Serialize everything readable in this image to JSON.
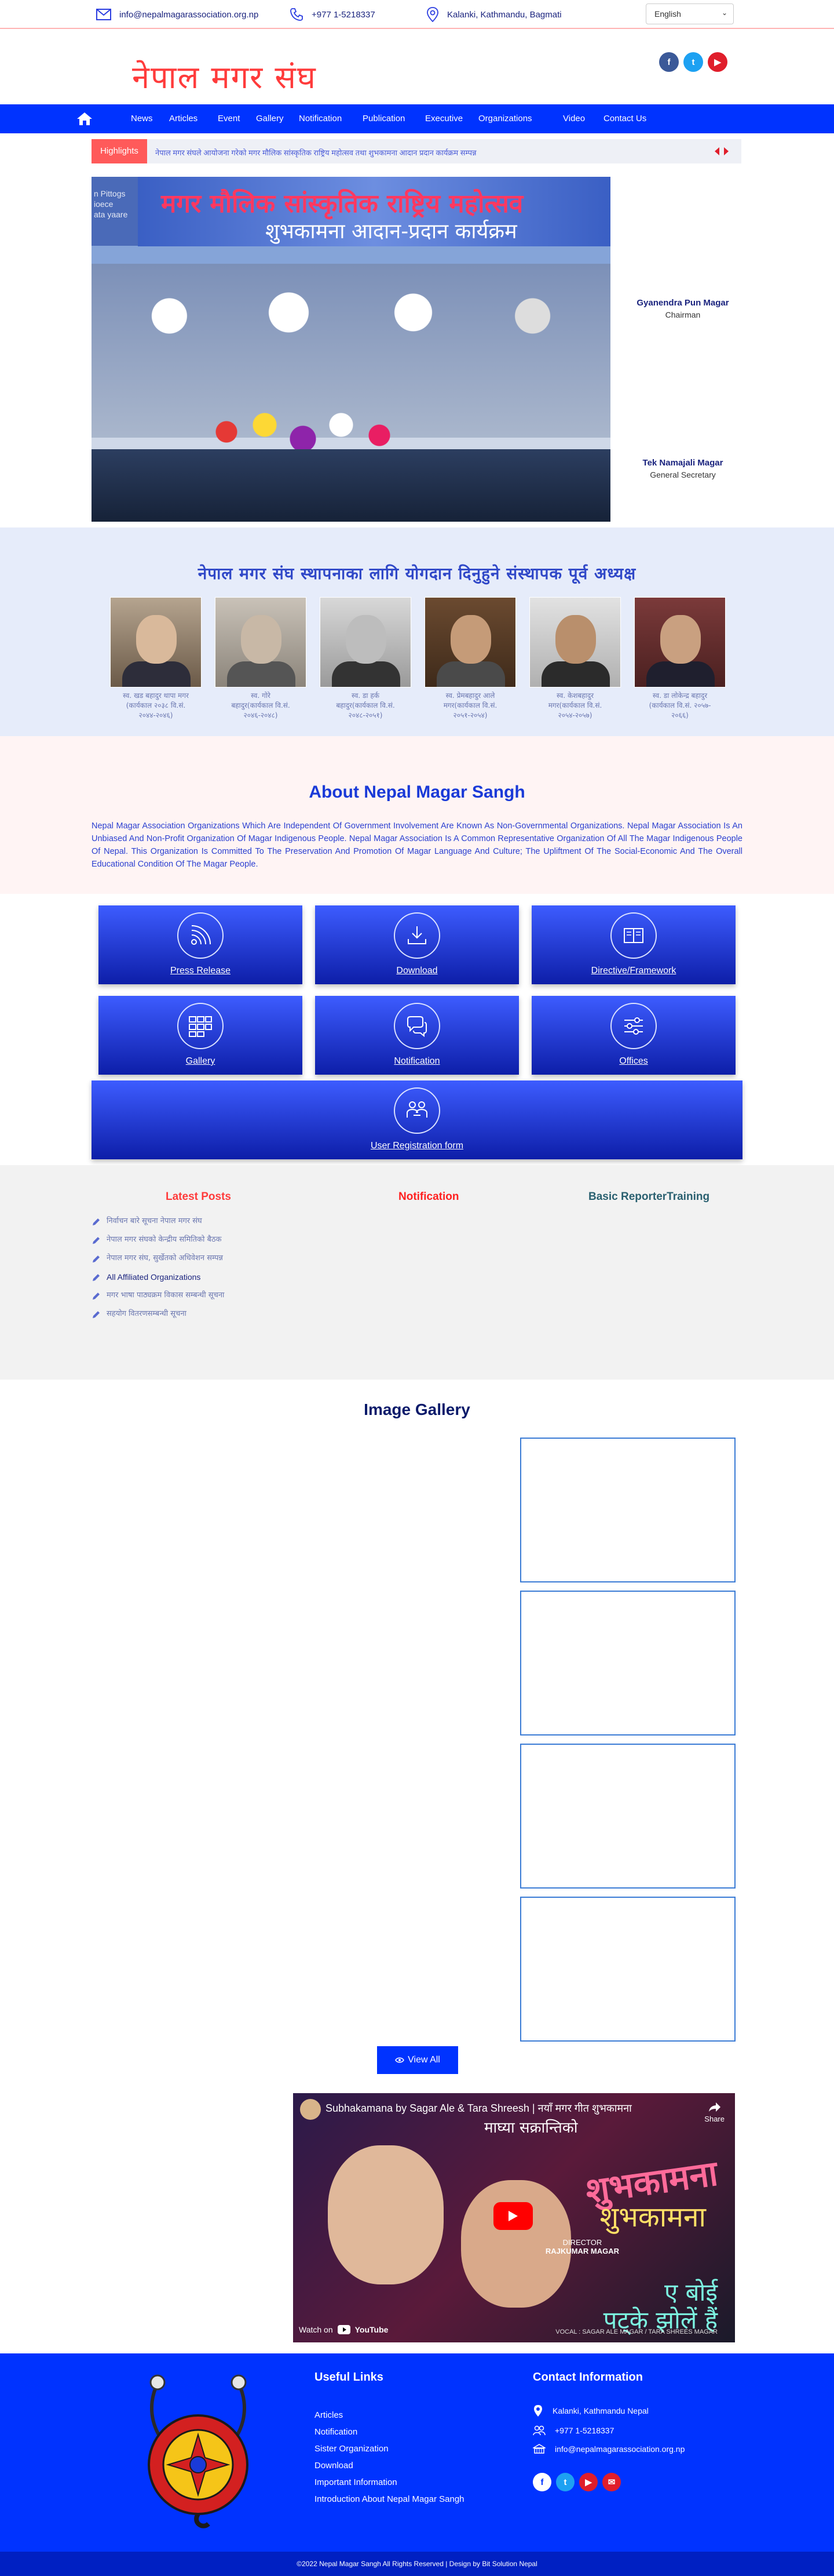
{
  "topbar": {
    "email": "info@nepalmagarassociation.org.np",
    "phone": "+977 1-5218337",
    "address": "Kalanki, Kathmandu, Bagmati",
    "language": "English"
  },
  "header": {
    "logo_text": "नेपाल मगर संघ",
    "social": [
      "facebook-icon",
      "twitter-icon",
      "youtube-icon"
    ]
  },
  "nav": {
    "items": [
      "News",
      "Articles",
      "Event",
      "Gallery",
      "Notification",
      "Publication",
      "Executive",
      "Organizations",
      "Video",
      "Contact Us"
    ]
  },
  "highlights": {
    "label": "Highlights",
    "ticker": "नेपाल मगर संघले आयोजना गरेको मगर मौलिक सांस्कृतिक राष्ट्रिय महोत्सव तथा शुभकामना आदान प्रदान कार्यक्रम सम्पन्न"
  },
  "hero": {
    "banner_title": "मगर मौलिक सांस्कृतिक राष्ट्रिय महोत्सव",
    "banner_sub": "शुभकामना आदान-प्रदान कार्यक्रम",
    "side_text": [
      "n Pittogs",
      "ioece",
      "ata yaare"
    ]
  },
  "leaders": [
    {
      "name": "Gyanendra Pun Magar",
      "role": "Chairman"
    },
    {
      "name": "Tek Namajali Magar",
      "role": "General Secretary"
    }
  ],
  "founders": {
    "title": "नेपाल मगर संघ स्थापनाका लागि योगदान दिनुहुने संस्थापक पूर्व अध्यक्ष",
    "people": [
      {
        "line1": "स्व. खड बहादुर थापा मगर",
        "line2": "(कार्यकाल २०३८ वि.सं.",
        "line3": "२०४४-२०४६)"
      },
      {
        "line1": "स्व. गोरे",
        "line2": "बहादुर(कार्यकाल वि.सं.",
        "line3": "२०४६-२०४८)"
      },
      {
        "line1": "स्व. डा हर्क",
        "line2": "बहादुर(कार्यकाल वि.सं.",
        "line3": "२०४८-२०५१)"
      },
      {
        "line1": "स्व. प्रेमबहादुर आले",
        "line2": "मगर(कार्यकाल वि.सं.",
        "line3": "२०५१-२०५४)"
      },
      {
        "line1": "स्व. केशबहादुर",
        "line2": "मगर(कार्यकाल वि.सं.",
        "line3": "२०५४-२०५७)"
      },
      {
        "line1": "स्व. डा लोकेन्द्र बहादुर",
        "line2": "(कार्यकाल वि.सं. २०५७-",
        "line3": "२०६६)"
      }
    ]
  },
  "about": {
    "title": "About Nepal Magar Sangh",
    "body": "Nepal Magar Association Organizations Which Are Independent Of Government Involvement Are Known As Non-Governmental Organizations. Nepal Magar Association Is An Unbiased And Non-Profit Organization Of Magar Indigenous People. Nepal Magar Association Is A Common Representative Organization Of All The Magar Indigenous People Of Nepal. This Organization Is Committed To The Preservation And Promotion Of Magar Language And Culture; The Upliftment Of The Social-Economic And The Overall Educational Condition Of The Magar People."
  },
  "tiles": [
    {
      "label": "Press Release",
      "icon": "rss-icon"
    },
    {
      "label": "Download",
      "icon": "download-icon"
    },
    {
      "label": "Directive/Framework",
      "icon": "book-icon"
    },
    {
      "label": "Gallery",
      "icon": "gallery-icon"
    },
    {
      "label": "Notification",
      "icon": "chat-icon"
    },
    {
      "label": "Offices",
      "icon": "sliders-icon"
    },
    {
      "label": "User Registration form",
      "icon": "users-icon"
    }
  ],
  "posts": {
    "latest_title": "Latest Posts",
    "notification_title": "Notification",
    "training_title": "Basic ReporterTraining",
    "items": [
      "निर्वाचन बारे सूचना नेपाल मगर संघ",
      "नेपाल मगर संघको केन्द्रीय समितिको बैठक",
      "नेपाल मगर संघ, सुर्खेतको अधिवेशन सम्पन्न",
      "All Affiliated Organizations",
      "मगर भाषा पाठ्यक्रम विकास सम्बन्धी सूचना",
      "सहयोग वितरणसम्बन्धी सूचना"
    ]
  },
  "gallery": {
    "title": "Image Gallery",
    "view_all": "View All"
  },
  "video": {
    "title": "Subhakamana by Sagar Ale & Tara Shreesh | नयाँ मगर गीत शुभकामना",
    "share": "Share",
    "headline": "माघ्या सक्रान्तिको",
    "big1": "शुभकामना",
    "big2": "शुभकामना",
    "big3": "ए बोई\nपट्के झोलें हैं",
    "director_label": "DIRECTOR",
    "director_name": "RAJKUMAR MAGAR",
    "vocal": "VOCAL : SAGAR ALE MAGAR / TARA SHREES MAGAR",
    "watch_on": "Watch on",
    "youtube": "YouTube"
  },
  "footer": {
    "useful_title": "Useful Links",
    "links": [
      "Articles",
      "Notification",
      "Sister Organization",
      "Download",
      "Important Information",
      "Introduction About Nepal Magar Sangh"
    ],
    "contact_title": "Contact Information",
    "address": "Kalanki, Kathmandu Nepal",
    "phone": "+977 1-5218337",
    "email": "info@nepalmagarassociation.org.np",
    "copyright": "©2022 Nepal Magar Sangh All Rights Reserved | Design by Bit Solution Nepal"
  },
  "colors": {
    "brand_blue": "#0033ff",
    "accent_red": "#ff3b3b",
    "facebook": "#3b5998",
    "twitter": "#1da1f2",
    "youtube": "#e01e2b"
  }
}
